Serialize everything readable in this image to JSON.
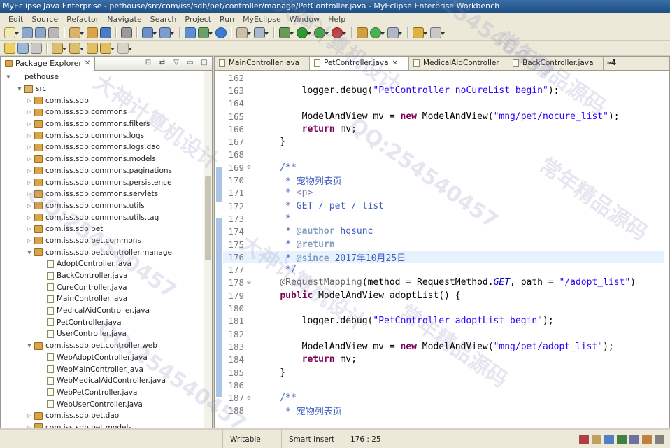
{
  "window": {
    "title": "MyEclipse Java Enterprise - pethouse/src/com/iss/sdb/pet/controller/manage/PetController.java - MyEclipse Enterprise Workbench"
  },
  "menu": [
    "Edit",
    "Source",
    "Refactor",
    "Navigate",
    "Search",
    "Project",
    "Run",
    "MyEclipse",
    "Window",
    "Help"
  ],
  "explorer": {
    "tab_label": "Package Explorer",
    "close_glyph": "✕",
    "items": [
      {
        "label": "pethouse",
        "kind": "project"
      },
      {
        "label": "src",
        "kind": "src"
      },
      {
        "label": "com.iss.sdb",
        "kind": "pkg"
      },
      {
        "label": "com.iss.sdb.commons",
        "kind": "pkg"
      },
      {
        "label": "com.iss.sdb.commons.filters",
        "kind": "pkg"
      },
      {
        "label": "com.iss.sdb.commons.logs",
        "kind": "pkg"
      },
      {
        "label": "com.iss.sdb.commons.logs.dao",
        "kind": "pkg"
      },
      {
        "label": "com.iss.sdb.commons.models",
        "kind": "pkg"
      },
      {
        "label": "com.iss.sdb.commons.paginations",
        "kind": "pkg"
      },
      {
        "label": "com.iss.sdb.commons.persistence",
        "kind": "pkg"
      },
      {
        "label": "com.iss.sdb.commons.servlets",
        "kind": "pkg"
      },
      {
        "label": "com.iss.sdb.commons.utils",
        "kind": "pkg"
      },
      {
        "label": "com.iss.sdb.commons.utils.tag",
        "kind": "pkg"
      },
      {
        "label": "com.iss.sdb.pet",
        "kind": "pkg"
      },
      {
        "label": "com.iss.sdb.pet.commons",
        "kind": "pkg"
      },
      {
        "label": "com.iss.sdb.pet.controller.manage",
        "kind": "pkg"
      },
      {
        "label": "AdoptController.java",
        "kind": "java"
      },
      {
        "label": "BackController.java",
        "kind": "java"
      },
      {
        "label": "CureController.java",
        "kind": "java"
      },
      {
        "label": "MainController.java",
        "kind": "java"
      },
      {
        "label": "MedicalAidController.java",
        "kind": "java"
      },
      {
        "label": "PetController.java",
        "kind": "java"
      },
      {
        "label": "UserController.java",
        "kind": "java"
      },
      {
        "label": "com.iss.sdb.pet.controller.web",
        "kind": "pkg"
      },
      {
        "label": "WebAdoptController.java",
        "kind": "java"
      },
      {
        "label": "WebMainController.java",
        "kind": "java"
      },
      {
        "label": "WebMedicalAidController.java",
        "kind": "java"
      },
      {
        "label": "WebPetController.java",
        "kind": "java"
      },
      {
        "label": "WebUserController.java",
        "kind": "java"
      },
      {
        "label": "com.iss.sdb.pet.dao",
        "kind": "pkg"
      },
      {
        "label": "com.iss.sdb.pet.models",
        "kind": "pkg"
      }
    ]
  },
  "editor": {
    "tabs": [
      {
        "label": "MainController.java",
        "active": false,
        "closable": false
      },
      {
        "label": "PetController.java",
        "active": true,
        "closable": true
      },
      {
        "label": "MedicalAidController",
        "active": false,
        "closable": false
      },
      {
        "label": "BackController.java",
        "active": false,
        "closable": false
      }
    ],
    "overflow_label": "»4",
    "lines": [
      {
        "n": "162",
        "text": ""
      },
      {
        "n": "163",
        "text": "        logger.debug(\"PetController noCureList begin\");"
      },
      {
        "n": "164",
        "text": ""
      },
      {
        "n": "165",
        "text": "        ModelAndView mv = new ModelAndView(\"mng/pet/nocure_list\");"
      },
      {
        "n": "166",
        "text": "        return mv;"
      },
      {
        "n": "167",
        "text": "    }"
      },
      {
        "n": "168",
        "text": ""
      },
      {
        "n": "169",
        "text": "    /**",
        "fold": "⊖"
      },
      {
        "n": "170",
        "text": "     * 宠物列表页"
      },
      {
        "n": "171",
        "text": "     * <p>"
      },
      {
        "n": "172",
        "text": "     * GET / pet / list"
      },
      {
        "n": "173",
        "text": "     *"
      },
      {
        "n": "174",
        "text": "     * @author hqsunc"
      },
      {
        "n": "175",
        "text": "     * @return"
      },
      {
        "n": "176",
        "text": "     * @since 2017年10月25日",
        "highlight": true
      },
      {
        "n": "177",
        "text": "     */"
      },
      {
        "n": "178",
        "text": "    @RequestMapping(method = RequestMethod.GET, path = \"/adopt_list\")",
        "fold": "⊖"
      },
      {
        "n": "179",
        "text": "    public ModelAndView adoptList() {"
      },
      {
        "n": "180",
        "text": ""
      },
      {
        "n": "181",
        "text": "        logger.debug(\"PetController adoptList begin\");"
      },
      {
        "n": "182",
        "text": ""
      },
      {
        "n": "183",
        "text": "        ModelAndView mv = new ModelAndView(\"mng/pet/adopt_list\");"
      },
      {
        "n": "184",
        "text": "        return mv;"
      },
      {
        "n": "185",
        "text": "    }"
      },
      {
        "n": "186",
        "text": ""
      },
      {
        "n": "187",
        "text": "    /**",
        "fold": "⊖"
      },
      {
        "n": "188",
        "text": "     * 宠物列表页"
      }
    ]
  },
  "status": {
    "mode": "Writable",
    "insert": "Smart Insert",
    "position": "176 : 25"
  },
  "watermarks": [
    "大神计算机设计",
    "QQ:254540457",
    "常年精品源码",
    "大神计算机设计",
    "QQ:254540457",
    "常年精品源码",
    "QQ:254540457",
    "大神计算机设计",
    "常年精品源码",
    "QQ:254540457"
  ],
  "colors": {
    "keyword": "#7f0055",
    "string": "#2a00ff",
    "javadoc": "#3f5fbf",
    "annotation": "#646464",
    "current_line": "#e8f2fe",
    "change_ruler": "#a9c4e4"
  }
}
